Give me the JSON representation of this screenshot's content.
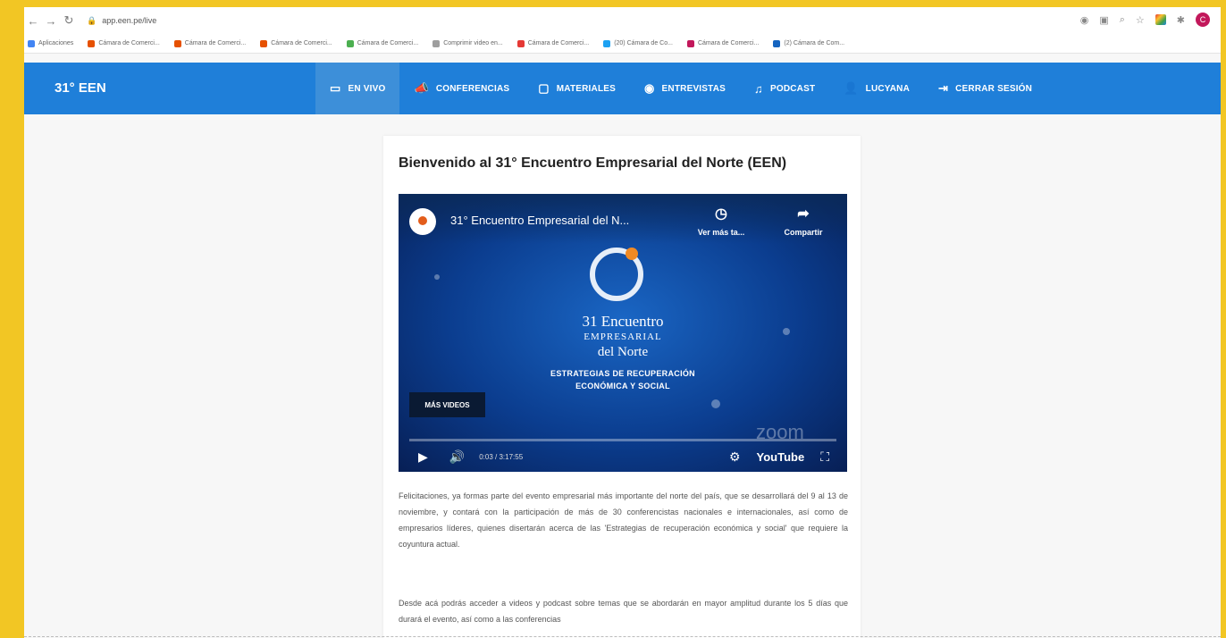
{
  "browser": {
    "url": "app.een.pe/live",
    "bookmarks": [
      {
        "label": "Aplicaciones",
        "color": "#4285f4"
      },
      {
        "label": "Cámara de Comerci...",
        "color": "#e65100"
      },
      {
        "label": "Cámara de Comerci...",
        "color": "#e65100"
      },
      {
        "label": "Cámara de Comerci...",
        "color": "#e65100"
      },
      {
        "label": "Cámara de Comerci...",
        "color": "#4caf50"
      },
      {
        "label": "Comprimir video en...",
        "color": "#9e9e9e"
      },
      {
        "label": "Cámara de Comerci...",
        "color": "#e53935"
      },
      {
        "label": "(20) Cámara de Co...",
        "color": "#1da1f2"
      },
      {
        "label": "Cámara de Comerci...",
        "color": "#c2185b"
      },
      {
        "label": "(2) Cámara de Com...",
        "color": "#1565c0"
      }
    ],
    "profile_initial": "C"
  },
  "app": {
    "brand": "31° EEN",
    "nav": [
      {
        "label": "EN VIVO",
        "icon": "camera-icon"
      },
      {
        "label": "CONFERENCIAS",
        "icon": "megaphone-icon"
      },
      {
        "label": "MATERIALES",
        "icon": "folder-icon"
      },
      {
        "label": "ENTREVISTAS",
        "icon": "play-circle-icon"
      },
      {
        "label": "PODCAST",
        "icon": "music-icon"
      },
      {
        "label": "LUCYANA",
        "icon": "person-icon"
      },
      {
        "label": "CERRAR SESIÓN",
        "icon": "logout-icon"
      }
    ],
    "active_nav": "EN VIVO",
    "accent": "#1f7fd9"
  },
  "main": {
    "title": "Bienvenido al 31° Encuentro Empresarial del Norte (EEN)",
    "video": {
      "title": "31° Encuentro Empresarial del N...",
      "watch_later": "Ver más ta...",
      "share": "Compartir",
      "emblem_line1": "31 Encuentro",
      "emblem_line2": "EMPRESARIAL",
      "emblem_line3": "del Norte",
      "tagline1": "ESTRATEGIAS DE RECUPERACIÓN",
      "tagline2": "ECONÓMICA Y SOCIAL",
      "more_videos": "MÁS VIDEOS",
      "watermark": "zoom",
      "time": "0:03 / 3:17:55",
      "youtube": "YouTube",
      "progress": 0.0
    },
    "paragraph1": "Felicitaciones, ya formas parte del evento empresarial más importante del norte del país, que se desarrollará del 9 al 13 de noviembre, y contará con la participación de más de 30 conferencistas nacionales e internacionales, así como de empresarios líderes, quienes disertarán acerca de las 'Estrategias de recuperación económica y social' que requiere la coyuntura actual.",
    "paragraph2": "Desde acá podrás acceder a videos y podcast sobre temas que se abordarán en mayor amplitud durante los 5 días que durará el evento, así como a las conferencias"
  }
}
